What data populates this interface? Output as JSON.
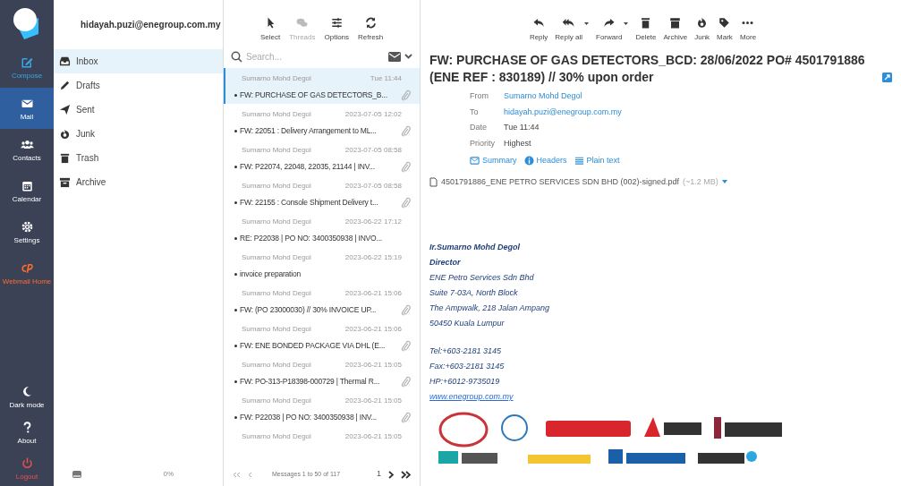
{
  "nav": [
    {
      "kind": "compose",
      "label": "Compose",
      "selected": false
    },
    {
      "kind": "mail",
      "label": "Mail",
      "selected": true
    },
    {
      "kind": "contacts",
      "label": "Contacts",
      "selected": false
    },
    {
      "kind": "calendar",
      "label": "Calendar",
      "selected": false
    },
    {
      "kind": "settings",
      "label": "Settings",
      "selected": false
    },
    {
      "kind": "cpanel",
      "label": "Webmail Home",
      "selected": false
    }
  ],
  "nav_bottom": [
    {
      "kind": "moon",
      "label": "Dark mode"
    },
    {
      "kind": "about",
      "label": "About"
    },
    {
      "kind": "logout",
      "label": "Logout"
    }
  ],
  "account": "hidayah.puzi@enegroup.com.my",
  "folders": [
    {
      "kind": "inbox",
      "label": "Inbox",
      "selected": true
    },
    {
      "kind": "drafts",
      "label": "Drafts",
      "selected": false
    },
    {
      "kind": "sent",
      "label": "Sent",
      "selected": false
    },
    {
      "kind": "junk",
      "label": "Junk",
      "selected": false
    },
    {
      "kind": "trash",
      "label": "Trash",
      "selected": false
    },
    {
      "kind": "archive",
      "label": "Archive",
      "selected": false
    }
  ],
  "quota": "0%",
  "list_toolbar": [
    {
      "kind": "select",
      "label": "Select",
      "disabled": false
    },
    {
      "kind": "threads",
      "label": "Threads",
      "disabled": true
    },
    {
      "kind": "options",
      "label": "Options",
      "disabled": false
    },
    {
      "kind": "refresh",
      "label": "Refresh",
      "disabled": false
    }
  ],
  "search": {
    "placeholder": "Search..."
  },
  "messages": [
    {
      "from": "Sumarno Mohd Degol",
      "date": "Tue 11:44",
      "subject": "FW: PURCHASE OF GAS DETECTORS_B...",
      "attachment": true,
      "selected": true
    },
    {
      "from": "Sumarno Mohd Degol",
      "date": "2023-07-05 12:02",
      "subject": "FW: 22051 : Delivery Arrangement to ML...",
      "attachment": true,
      "selected": false
    },
    {
      "from": "Sumarno Mohd Degol",
      "date": "2023-07-05 08:58",
      "subject": "FW: P22074, 22048, 22035, 21144 | INV...",
      "attachment": true,
      "selected": false
    },
    {
      "from": "Sumarno Mohd Degol",
      "date": "2023-07-05 08:58",
      "subject": "FW: 22155 : Console Shipment Delivery t...",
      "attachment": true,
      "selected": false
    },
    {
      "from": "Sumarno Mohd Degol",
      "date": "2023-06-22 17:12",
      "subject": "RE: P22038 | PO NO: 3400350938 | INVO...",
      "attachment": false,
      "selected": false
    },
    {
      "from": "Sumarno Mohd Degol",
      "date": "2023-06-22 15:19",
      "subject": "invoice preparation",
      "attachment": false,
      "selected": false
    },
    {
      "from": "Sumarno Mohd Degol",
      "date": "2023-06-21 15:06",
      "subject": "FW: (PO 23000030) // 30% INVOICE UP...",
      "attachment": true,
      "selected": false
    },
    {
      "from": "Sumarno Mohd Degol",
      "date": "2023-06-21 15:06",
      "subject": "FW: ENE BONDED PACKAGE VIA DHL (E...",
      "attachment": true,
      "selected": false
    },
    {
      "from": "Sumarno Mohd Degol",
      "date": "2023-06-21 15:05",
      "subject": "FW: PO-313-P18398-000729 | Thermal R...",
      "attachment": true,
      "selected": false
    },
    {
      "from": "Sumarno Mohd Degol",
      "date": "2023-06-21 15:05",
      "subject": "FW: P22038 | PO NO: 3400350938 | INV...",
      "attachment": true,
      "selected": false
    },
    {
      "from": "Sumarno Mohd Degol",
      "date": "2023-06-21 15:05",
      "selected": false
    }
  ],
  "pager": {
    "count": "Messages 1 to 50 of 117",
    "page": "1"
  },
  "message_toolbar": [
    {
      "kind": "reply",
      "label": "Reply",
      "menu": false
    },
    {
      "kind": "replyall",
      "label": "Reply all",
      "menu": true
    },
    {
      "kind": "forward",
      "label": "Forward",
      "menu": true
    },
    {
      "kind": "delete",
      "label": "Delete",
      "menu": false
    },
    {
      "kind": "archive",
      "label": "Archive",
      "menu": false
    },
    {
      "kind": "junk",
      "label": "Junk",
      "menu": false
    },
    {
      "kind": "mark",
      "label": "Mark",
      "menu": false
    },
    {
      "kind": "more",
      "label": "More",
      "menu": false
    }
  ],
  "message": {
    "subject": "FW: PURCHASE OF GAS DETECTORS_BCD: 28/06/2022 PO# 4501791886 (ENE REF : 830189) // 30% upon order",
    "headers": [
      {
        "label": "From",
        "value": "Sumarno Mohd Degol",
        "link": true
      },
      {
        "label": "To",
        "value": "hidayah.puzi@enegroup.com.my",
        "link": true
      },
      {
        "label": "Date",
        "value": "Tue 11:44",
        "link": false
      },
      {
        "label": "Priority",
        "value": "Highest",
        "link": false
      }
    ],
    "views": [
      {
        "kind": "summary",
        "label": "Summary"
      },
      {
        "kind": "headers",
        "label": "Headers"
      },
      {
        "kind": "plain",
        "label": "Plain text"
      }
    ],
    "attachment": {
      "name": "4501791886_ENE PETRO SERVICES SDN BHD (002)-signed.pdf",
      "size": "(~1.2 MB)"
    },
    "signature": [
      {
        "kind": "bold",
        "text": "Ir.Sumarno Mohd Degol"
      },
      {
        "kind": "bold",
        "text": "Director"
      },
      {
        "kind": "plain",
        "text": "ENE Petro Services Sdn Bhd"
      },
      {
        "kind": "plain",
        "text": "Suite 7-03A, North Block"
      },
      {
        "kind": "plain",
        "text": "The Ampwalk, 218 Jalan Ampang"
      },
      {
        "kind": "plain",
        "text": "50450 Kuala Lumpur"
      },
      {
        "kind": "gap"
      },
      {
        "kind": "plain",
        "text": "Tel:+603-2181 3145"
      },
      {
        "kind": "plain",
        "text": "Fax:+603-2181 3145"
      },
      {
        "kind": "plain",
        "text": "HP:+6012-9735019"
      },
      {
        "kind": "link",
        "text": "www.enegroup.com.my"
      }
    ]
  }
}
